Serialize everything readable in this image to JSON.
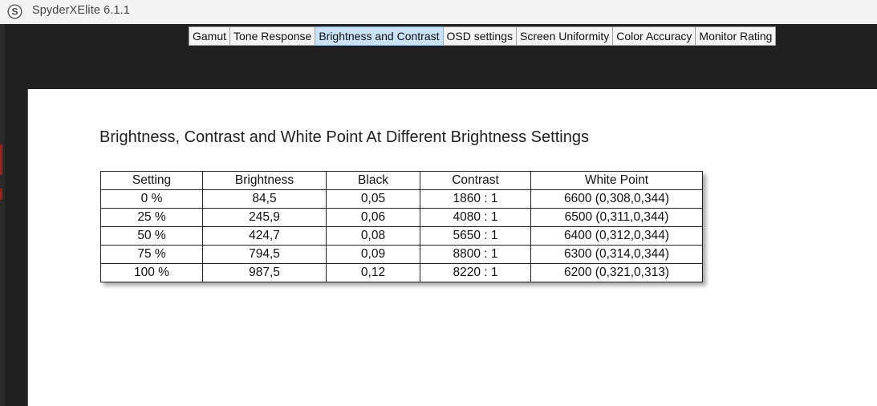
{
  "window": {
    "title": "SpyderXElite 6.1.1",
    "icon": "spyder-s-icon"
  },
  "tabs": [
    {
      "label": "Gamut",
      "active": false
    },
    {
      "label": "Tone Response",
      "active": false
    },
    {
      "label": "Brightness and Contrast",
      "active": true
    },
    {
      "label": "OSD settings",
      "active": false
    },
    {
      "label": "Screen Uniformity",
      "active": false
    },
    {
      "label": "Color Accuracy",
      "active": false
    },
    {
      "label": "Monitor Rating",
      "active": false
    }
  ],
  "report": {
    "title": "Brightness, Contrast and White Point At Different Brightness Settings",
    "columns": [
      "Setting",
      "Brightness",
      "Black",
      "Contrast",
      "White Point"
    ],
    "rows": [
      [
        "0 %",
        "84,5",
        "0,05",
        "1860 : 1",
        "6600 (0,308,0,344)"
      ],
      [
        "25 %",
        "245,9",
        "0,06",
        "4080 : 1",
        "6500 (0,311,0,344)"
      ],
      [
        "50 %",
        "424,7",
        "0,08",
        "5650 : 1",
        "6400 (0,312,0,344)"
      ],
      [
        "75 %",
        "794,5",
        "0,09",
        "8800 : 1",
        "6300 (0,314,0,344)"
      ],
      [
        "100 %",
        "987,5",
        "0,12",
        "8220 : 1",
        "6200 (0,321,0,313)"
      ]
    ]
  },
  "colors": {
    "active_tab": "#c9e2f9",
    "window_bg": "#202020",
    "titlebar_bg": "#f3f3f3"
  }
}
